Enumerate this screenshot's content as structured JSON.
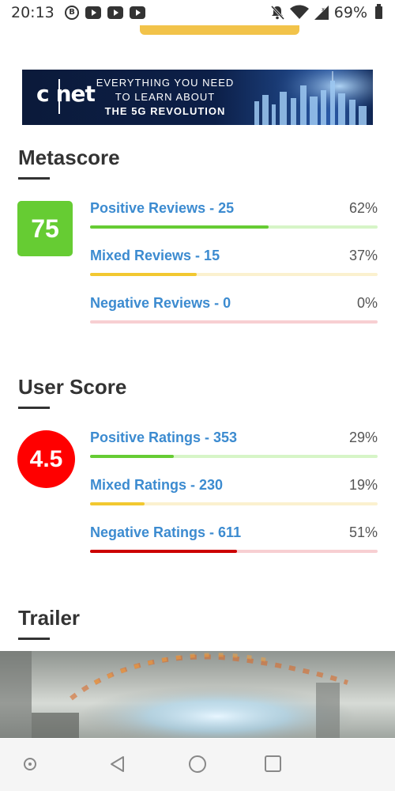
{
  "status_bar": {
    "time": "20:13",
    "battery": "69%",
    "left_icons": [
      "b-icon",
      "youtube-icon",
      "youtube-icon",
      "youtube-icon"
    ],
    "right_icons": [
      "mute-icon",
      "wifi-icon",
      "signal-icon",
      "battery-icon"
    ]
  },
  "ad": {
    "logo": "c|net",
    "line1": "EVERYTHING YOU NEED",
    "line2": "TO LEARN ABOUT",
    "line3": "THE 5G REVOLUTION"
  },
  "metascore": {
    "title": "Metascore",
    "score": "75",
    "score_color": "#66cc33",
    "rows": [
      {
        "label": "Positive Reviews - 25",
        "pct": "62%",
        "fill": 0.62,
        "color": "#66cc33",
        "track": "#d6f5c7"
      },
      {
        "label": "Mixed Reviews - 15",
        "pct": "37%",
        "fill": 0.37,
        "color": "#f2c830",
        "track": "#fbf1cf"
      },
      {
        "label": "Negative Reviews - 0",
        "pct": "0%",
        "fill": 0.0,
        "color": "#ff0000",
        "track": "#f7cfd2"
      }
    ]
  },
  "userscore": {
    "title": "User Score",
    "score": "4.5",
    "score_color": "#ff0000",
    "rows": [
      {
        "label": "Positive Ratings - 353",
        "pct": "29%",
        "fill": 0.29,
        "color": "#66cc33",
        "track": "#d6f5c7"
      },
      {
        "label": "Mixed Ratings - 230",
        "pct": "19%",
        "fill": 0.19,
        "color": "#f2c830",
        "track": "#fbf1cf"
      },
      {
        "label": "Negative Ratings - 611",
        "pct": "51%",
        "fill": 0.51,
        "color": "#cc0000",
        "track": "#f7cfd2"
      }
    ]
  },
  "trailer": {
    "title": "Trailer"
  },
  "nav_bar": {
    "icons": [
      "assistant-dot-icon",
      "back-icon",
      "home-icon",
      "recents-icon"
    ]
  }
}
